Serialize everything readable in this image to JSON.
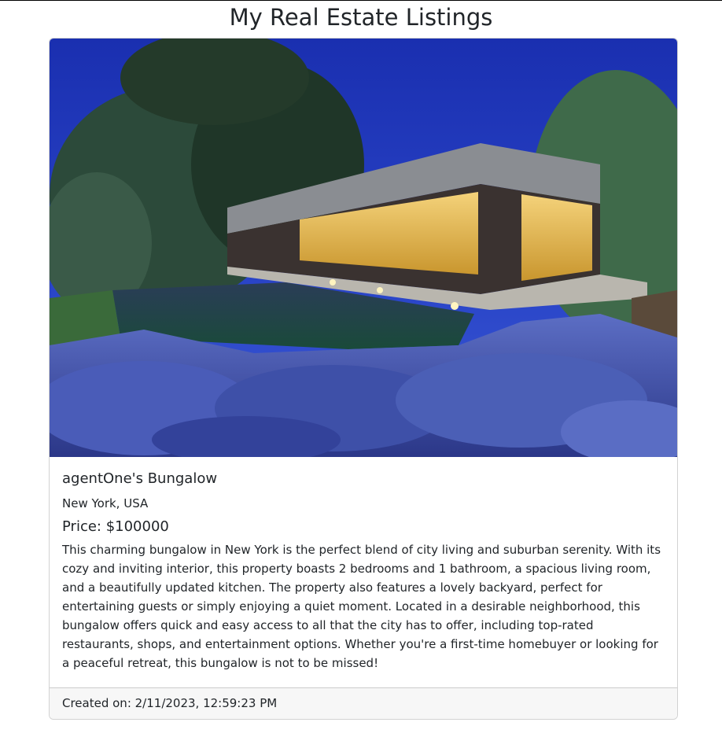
{
  "page": {
    "title": "My Real Estate Listings"
  },
  "listing": {
    "title": "agentOne's Bungalow",
    "location": "New York, USA",
    "price": "Price: $100000",
    "description": "This charming bungalow in New York is the perfect blend of city living and suburban serenity. With its cozy and inviting interior, this property boasts 2 bedrooms and 1 bathroom, a spacious living room, and a beautifully updated kitchen. The property also features a lovely backyard, perfect for entertaining guests or simply enjoying a quiet moment. Located in a desirable neighborhood, this bungalow offers quick and easy access to all that the city has to offer, including top-rated restaurants, shops, and entertainment options. Whether you're a first-time homebuyer or looking for a peaceful retreat, this bungalow is not to be missed!",
    "created": "Created on: 2/11/2023, 12:59:23 PM",
    "image_icon": "house-photo"
  }
}
